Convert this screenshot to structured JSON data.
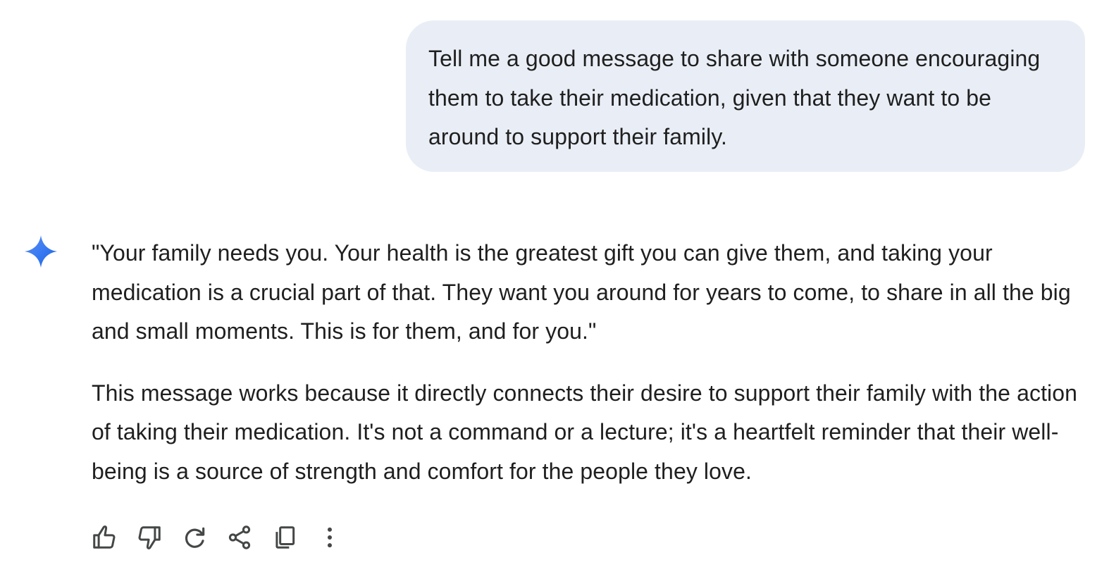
{
  "conversation": {
    "user_prompt": "Tell me a good message to share with someone encouraging them to take their medication, given that they want to be around to support their family.",
    "response": {
      "avatar_icon": "gemini-sparkle-icon",
      "paragraphs": [
        "\"Your family needs you. Your health is the greatest gift you can give them, and taking your medication is a crucial part of that. They want you around for years to come, to share in all the big and small moments. This is for them, and for you.\"",
        "This message works because it directly connects their desire to support their family with the action of taking their medication. It's not a command or a lecture; it's a heartfelt reminder that their well-being is a source of strength and comfort for the people they love."
      ]
    }
  },
  "actions": {
    "icons": [
      "thumbs-up-icon",
      "thumbs-down-icon",
      "regenerate-icon",
      "share-icon",
      "copy-icon",
      "more-options-icon"
    ]
  },
  "colors": {
    "user_bubble_bg": "#e9eef6",
    "text": "#1f1f1f",
    "icon": "#444746",
    "sparkle_start": "#4285f4",
    "sparkle_end": "#1a73e8"
  }
}
